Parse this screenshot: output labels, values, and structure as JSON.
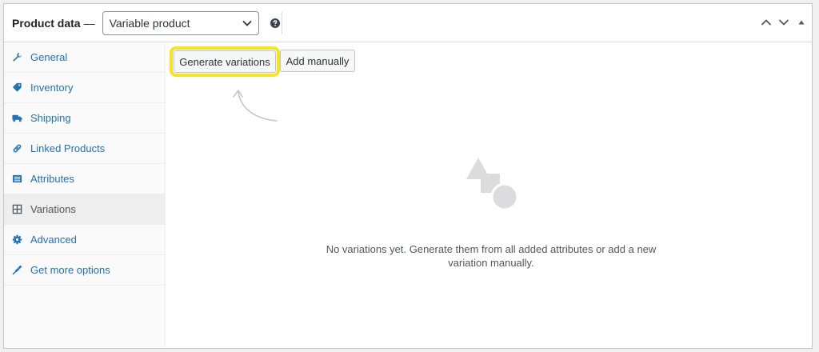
{
  "header": {
    "title": "Product data",
    "dash": "—",
    "product_type": {
      "selected": "Variable product",
      "options": [
        "Variable product"
      ]
    }
  },
  "tabs": [
    {
      "label": "General",
      "icon": "wrench-icon"
    },
    {
      "label": "Inventory",
      "icon": "tag-icon"
    },
    {
      "label": "Shipping",
      "icon": "truck-icon"
    },
    {
      "label": "Linked Products",
      "icon": "link-icon"
    },
    {
      "label": "Attributes",
      "icon": "list-icon"
    },
    {
      "label": "Variations",
      "icon": "grid-icon",
      "active": true
    },
    {
      "label": "Advanced",
      "icon": "gear-icon"
    },
    {
      "label": "Get more options",
      "icon": "plugin-icon"
    }
  ],
  "variations": {
    "generate_label": "Generate variations",
    "add_manually_label": "Add manually",
    "empty_line1": "No variations yet. Generate them from all added attributes or add a new",
    "empty_line2": "variation manually."
  },
  "colors": {
    "accent": "#2271b1",
    "highlight": "#f5e32a"
  }
}
